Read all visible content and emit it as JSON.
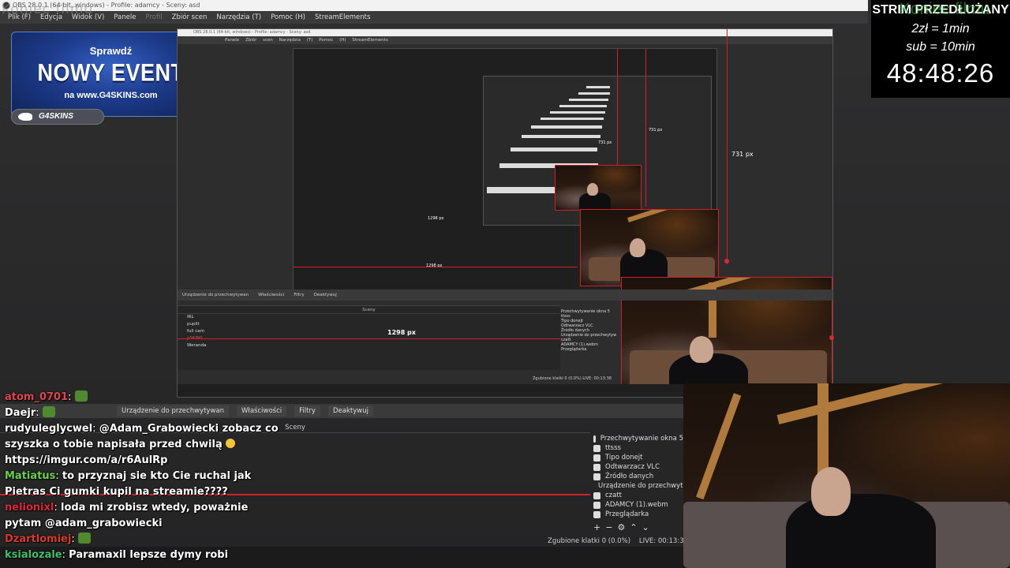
{
  "window": {
    "title": "OBS 28.0.1 (64-bit, windows) - Profile: adamcy - Sceny: asd",
    "overlay_text": "Koniec filmu"
  },
  "menu": {
    "items": [
      "Plik (F)",
      "Edycja",
      "Widok (V)",
      "Panele",
      "Profil",
      "Zbiór scen",
      "Narzędzia (T)",
      "Pomoc (H)",
      "StreamElements"
    ]
  },
  "banner": {
    "line1": "Sprawdź",
    "line2": "NOWY EVENT",
    "line3": "na www.G4SKINS.com",
    "logo": "G4SKINS"
  },
  "preview": {
    "px_label_large": "731 px",
    "px_label_mid": "731 px",
    "px_label_small": "731 px",
    "width_label_large": "1298 px",
    "width_label_mid": "1298 px",
    "width_label_small": "1298 px",
    "dock_tabs": [
      "Urządzenie do przechwytywan",
      "Właściwości",
      "Filtry",
      "Deaktywuj"
    ],
    "scenes_header": "Sceny",
    "scenes": [
      "IRL",
      "puplit",
      "full cam",
      "pSKINS",
      "Weranda"
    ],
    "sources": [
      "Przechwytywanie okna 5",
      "ttsss",
      "Tipo donejt",
      "Odtwarzacz VLC",
      "Źródło danych",
      "Urządzenie do przechwytyw",
      "czatt",
      "ADAMCY (1).webm",
      "Przeglądarka"
    ],
    "status": "Zgubione klatki 0 (0.0%)  LIVE: 00:13:38"
  },
  "docks": {
    "tabs": [
      "Urządzenie do przechwytywan",
      "Właściwości",
      "Filtry",
      "Deaktywuj"
    ],
    "scenes_header": "Sceny",
    "sources": [
      "Przechwytywanie okna 5",
      "ttsss",
      "Tipo donejt",
      "Odtwarzacz VLC",
      "Źródło danych",
      "Urządzenie do przechwytyw",
      "czatt",
      "ADAMCY (1).webm",
      "Przeglądarka"
    ],
    "controls": [
      "+",
      "−",
      "⚙",
      "⌃",
      "⌄"
    ],
    "status_frames": "Zgubione klatki 0 (0.0%)",
    "status_live": "LIVE: 00:13:38"
  },
  "timer": {
    "title": "STRIM PRZEDŁUŻANY",
    "ghost": "Koniec filmu",
    "rate1": "2zł = 1min",
    "rate2": "sub = 10min",
    "countdown": "48:48:26"
  },
  "chat": [
    {
      "user": "atom_0701",
      "user_color": "#e0444c",
      "text": ""
    },
    {
      "user": "Daejr",
      "user_color": "#ffffff",
      "text": ""
    },
    {
      "user": "rudyuleglycwel",
      "user_color": "#ffffff",
      "text": "@Adam_Grabowiecki zobacz co"
    },
    {
      "user": "",
      "user_color": "#ffffff",
      "text": "szyszka o tobie napisała przed chwilą"
    },
    {
      "user": "",
      "user_color": "#ffffff",
      "text": "https://imgur.com/a/r6AulRp"
    },
    {
      "user": "Matiatus",
      "user_color": "#6ad04a",
      "text": "to przyznaj sie kto Cie ruchal jak"
    },
    {
      "user": "",
      "user_color": "#ffffff",
      "text": "Pietras Ci gumki kupil na streamie????"
    },
    {
      "user": "nelionixl",
      "user_color": "#e0243a",
      "text": "loda mi zrobisz wtedy, poważnie"
    },
    {
      "user": "",
      "user_color": "#ffffff",
      "text": "pytam @adam_grabowiecki"
    },
    {
      "user": "Dzartlomiej",
      "user_color": "#d83a2a",
      "text": ""
    },
    {
      "user": "ksialozale",
      "user_color": "#3fbf6a",
      "text": "Paramaxil lepsze dymy robi"
    }
  ]
}
